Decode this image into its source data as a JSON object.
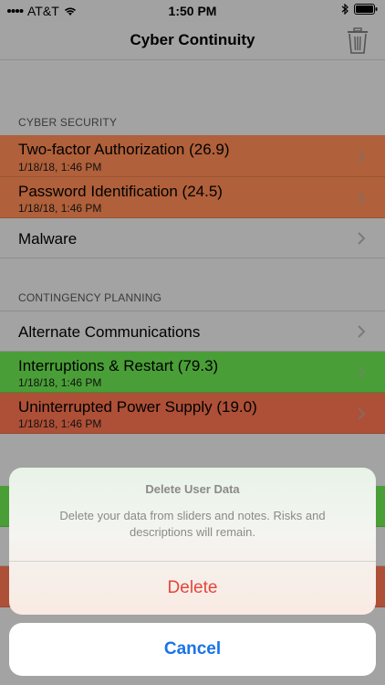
{
  "status_bar": {
    "carrier": "AT&T",
    "time": "1:50 PM"
  },
  "nav": {
    "title": "Cyber Continuity"
  },
  "sections": [
    {
      "header": "CYBER SECURITY",
      "rows": [
        {
          "label": "Two-factor Authorization (26.9)",
          "sub": "1/18/18, 1:46 PM",
          "color": "#b0603a"
        },
        {
          "label": "Password Identification (24.5)",
          "sub": "1/18/18, 1:46 PM",
          "color": "#b0603a"
        },
        {
          "label": "Malware",
          "sub": "",
          "color": "#a3a3a3"
        }
      ]
    },
    {
      "header": "CONTINGENCY PLANNING",
      "rows": [
        {
          "label": "Alternate Communications",
          "sub": "",
          "color": "#a3a3a3"
        },
        {
          "label": "Interruptions & Restart (79.3)",
          "sub": "1/18/18, 1:46 PM",
          "color": "#4a9e37"
        },
        {
          "label": "Uninterrupted Power Supply (19.0)",
          "sub": "1/18/18, 1:46 PM",
          "color": "#ad5037"
        }
      ]
    }
  ],
  "action_sheet": {
    "title": "Delete User Data",
    "message": "Delete your data from sliders and notes. Risks and descriptions will remain.",
    "delete_label": "Delete",
    "cancel_label": "Cancel"
  }
}
